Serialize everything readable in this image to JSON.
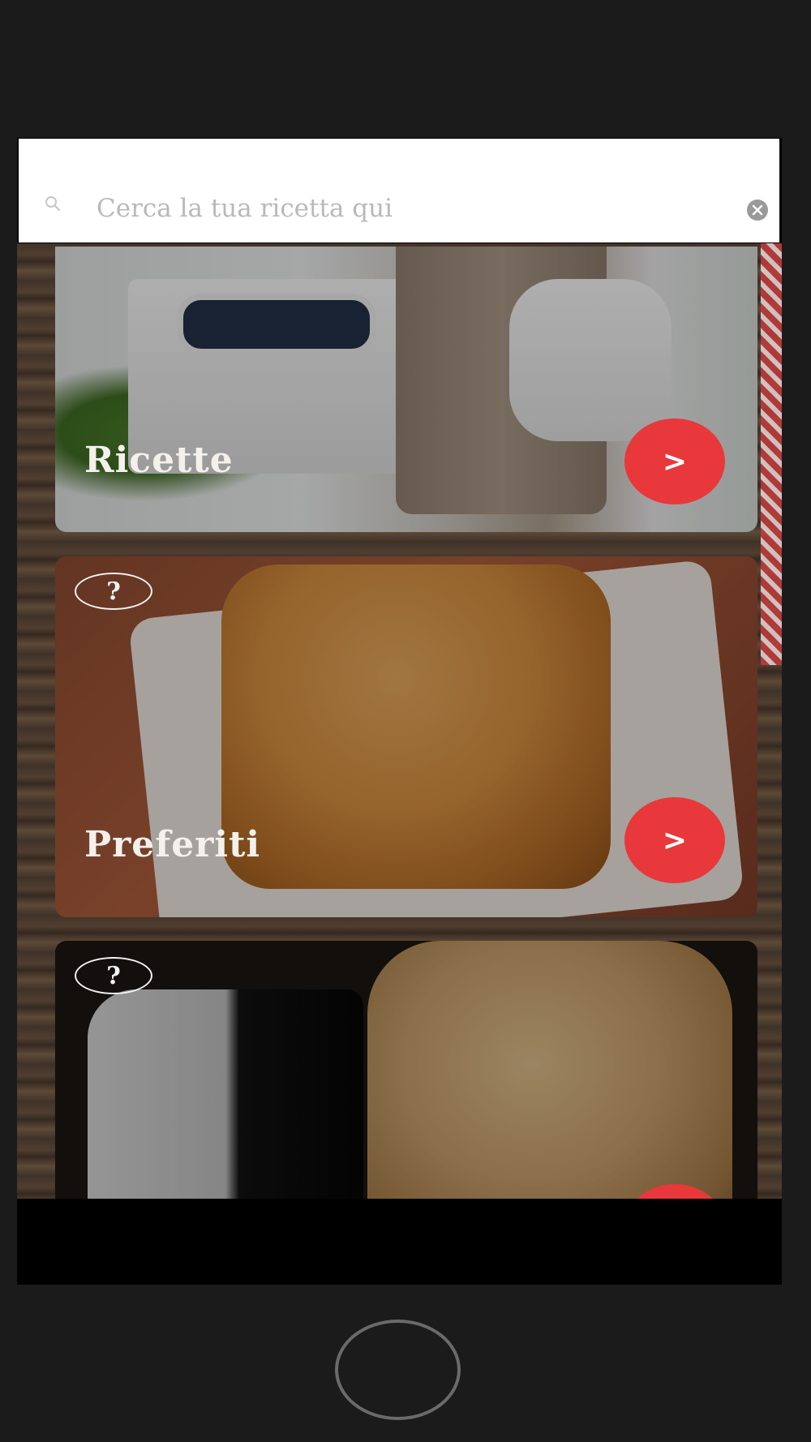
{
  "search": {
    "placeholder": "Cerca la tua ricetta qui"
  },
  "cards": [
    {
      "title": "Ricette",
      "button_label": ">",
      "has_help_badge": false
    },
    {
      "title": "Preferiti",
      "button_label": ">",
      "has_help_badge": true,
      "help_label": "?"
    },
    {
      "title": "",
      "button_label": ">",
      "has_help_badge": true,
      "help_label": "?"
    }
  ],
  "colors": {
    "accent": "#e8383b",
    "frame": "#1b1b1c",
    "search_background": "#ffffff",
    "placeholder_text": "#b9b9b9"
  },
  "icons": {
    "search": "search-icon",
    "clear": "clear-icon",
    "help": "question-icon",
    "arrow": "chevron-right-icon",
    "home": "home-button"
  }
}
